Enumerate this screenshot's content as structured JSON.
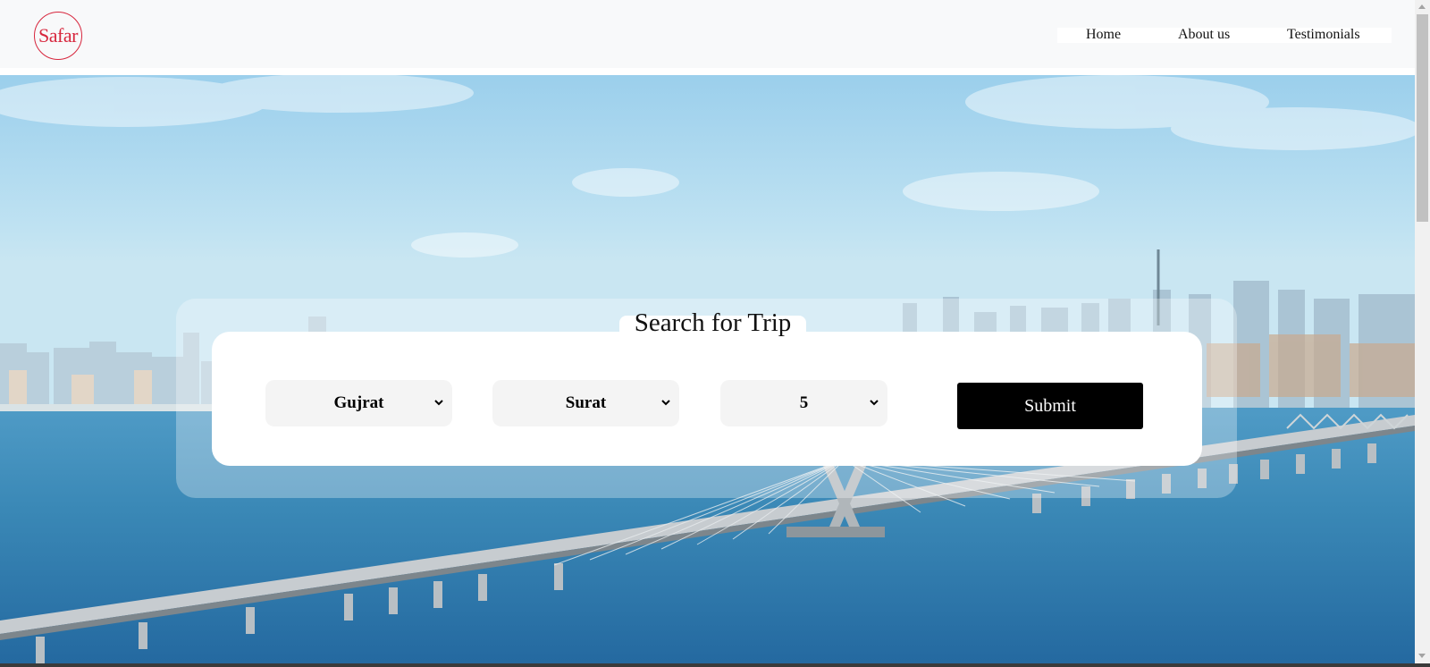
{
  "header": {
    "logo_text": "Safar",
    "nav": [
      {
        "label": "Home"
      },
      {
        "label": "About us"
      },
      {
        "label": "Testimonials"
      }
    ]
  },
  "search": {
    "title": "Search for Trip",
    "state_select": {
      "selected": "Gujrat"
    },
    "city_select": {
      "selected": "Surat"
    },
    "days_select": {
      "selected": "5"
    },
    "submit_label": "Submit"
  },
  "colors": {
    "logo": "#d7263d",
    "navbar_bg": "#f8f9fa",
    "submit_bg": "#000000",
    "select_bg": "#f4f4f4"
  },
  "icons": {
    "select_chevron": "chevron-down-icon",
    "hero_image": "sea-link-bridge-skyline"
  }
}
